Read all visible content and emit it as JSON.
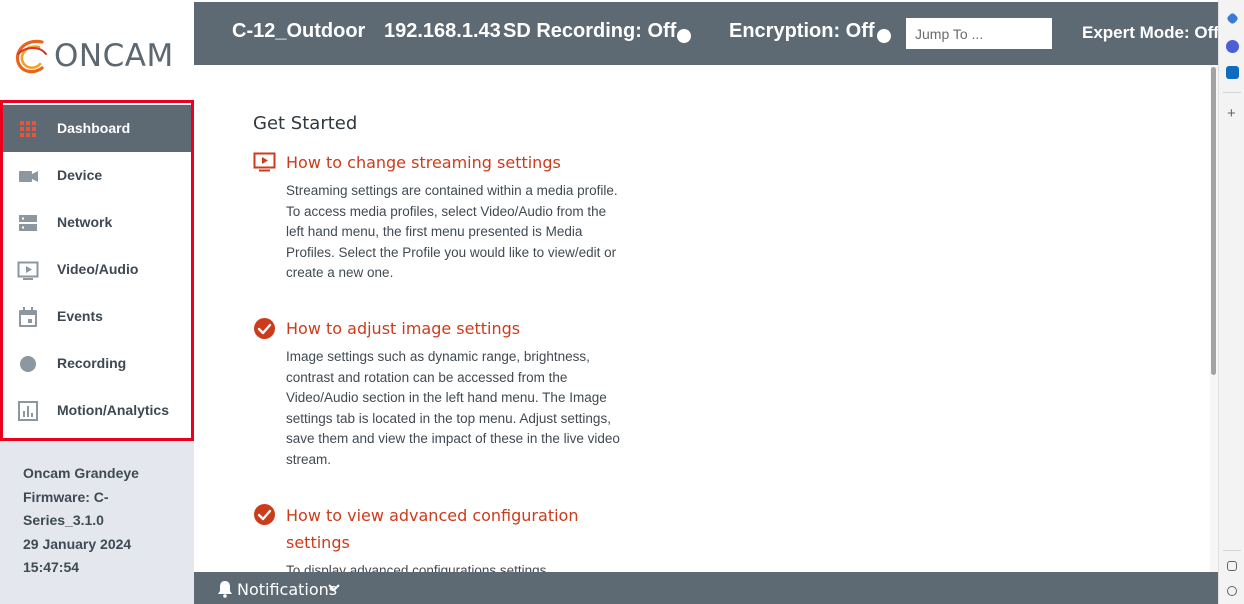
{
  "brand": {
    "logo_text": "ONCAM"
  },
  "header": {
    "camera_name": "C-12_Outdoor",
    "ip_address": "192.168.1.43",
    "sd_recording": "SD Recording: Off",
    "encryption": "Encryption: Off",
    "jump_placeholder": "Jump To ...",
    "expert_mode": "Expert Mode: Off"
  },
  "sidebar": {
    "items": [
      {
        "label": "Dashboard",
        "icon": "grid-icon",
        "active": true
      },
      {
        "label": "Device",
        "icon": "camera-icon"
      },
      {
        "label": "Network",
        "icon": "server-icon"
      },
      {
        "label": "Video/Audio",
        "icon": "play-screen-icon"
      },
      {
        "label": "Events",
        "icon": "calendar-icon"
      },
      {
        "label": "Recording",
        "icon": "record-dot-icon"
      },
      {
        "label": "Motion/Analytics",
        "icon": "bar-chart-icon"
      }
    ],
    "device_info": {
      "model": "Oncam Grandeye",
      "firmware": "Firmware: C-Series_3.1.0",
      "date": "29 January 2024",
      "time": "15:47:54"
    }
  },
  "main": {
    "title": "Get Started",
    "items": [
      {
        "icon": "play-screen-icon",
        "title": "How to change streaming settings",
        "description": "Streaming settings are contained within a media profile. To access media profiles, select Video/Audio from the left hand menu, the first menu presented is Media Profiles. Select the Profile you would like to view/edit or create a new one."
      },
      {
        "icon": "check-circle-icon",
        "title": "How to adjust image settings",
        "description": "Image settings such as dynamic range, brightness, contrast and rotation can be accessed from the Video/Audio section in the left hand menu. The Image settings tab is located in the top menu. Adjust settings, save them and view the impact of these in the live video stream."
      },
      {
        "icon": "check-circle-icon",
        "title": "How to view advanced configuration settings",
        "description": "To display advanced configurations settings"
      }
    ]
  },
  "notifications": {
    "label": "Notifications"
  },
  "colors": {
    "header_bg": "#5e6a73",
    "accent_red": "#cc3b1b",
    "highlight_border": "#e8001c",
    "sidebar_bg": "#e4e8ee"
  }
}
